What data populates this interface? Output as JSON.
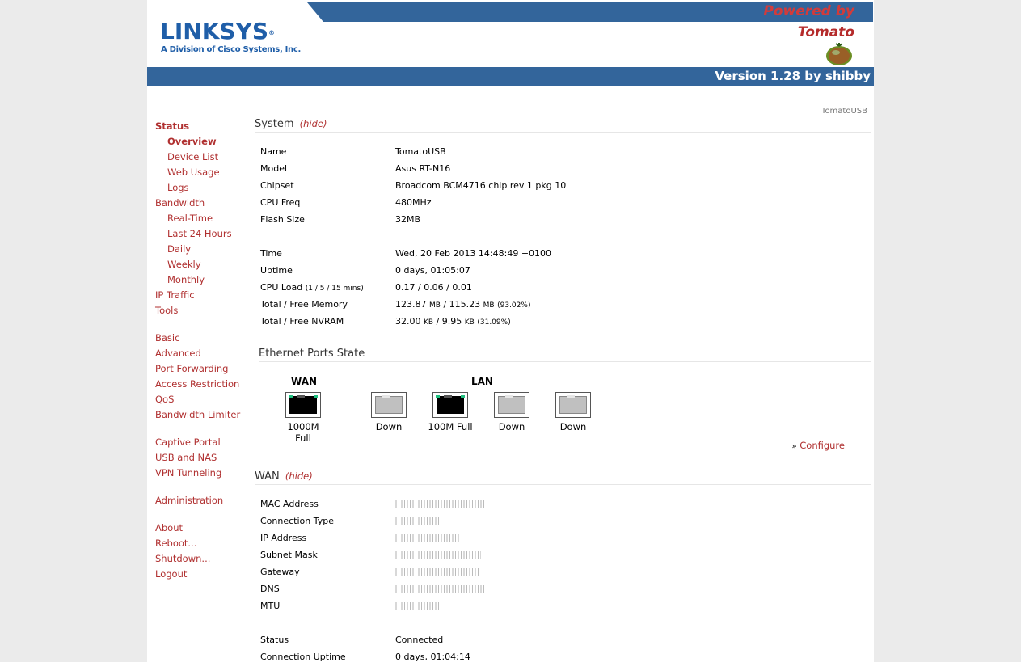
{
  "header": {
    "brand": "LINKSYS",
    "brand_sub": "A Division of Cisco Systems, Inc.",
    "powered_by": "Powered by",
    "tomato": "Tomato",
    "version": "Version 1.28 by shibby",
    "bar_color": "#33659b"
  },
  "nav": {
    "items": [
      {
        "label": "Status",
        "active": true
      },
      {
        "label": "Overview",
        "active": true
      },
      {
        "label": "Device List"
      },
      {
        "label": "Web Usage"
      },
      {
        "label": "Logs"
      },
      {
        "label": "Bandwidth"
      },
      {
        "label": "Real-Time"
      },
      {
        "label": "Last 24 Hours"
      },
      {
        "label": "Daily"
      },
      {
        "label": "Weekly"
      },
      {
        "label": "Monthly"
      },
      {
        "label": "IP Traffic"
      },
      {
        "label": "Tools"
      },
      {
        "label": "Basic"
      },
      {
        "label": "Advanced"
      },
      {
        "label": "Port Forwarding"
      },
      {
        "label": "Access Restriction"
      },
      {
        "label": "QoS"
      },
      {
        "label": "Bandwidth Limiter"
      },
      {
        "label": "Captive Portal"
      },
      {
        "label": "USB and NAS"
      },
      {
        "label": "VPN Tunneling"
      },
      {
        "label": "Administration"
      },
      {
        "label": "About"
      },
      {
        "label": "Reboot..."
      },
      {
        "label": "Shutdown..."
      },
      {
        "label": "Logout"
      }
    ],
    "link_color": "#b03030"
  },
  "content": {
    "site_name": "TomatoUSB",
    "system": {
      "title": "System",
      "hide": "(hide)",
      "rows": [
        {
          "label": "Name",
          "value": "TomatoUSB"
        },
        {
          "label": "Model",
          "value": "Asus RT-N16"
        },
        {
          "label": "Chipset",
          "value": "Broadcom BCM4716 chip rev 1 pkg 10"
        },
        {
          "label": "CPU Freq",
          "value": "480MHz"
        },
        {
          "label": "Flash Size",
          "value": "32MB"
        },
        {
          "label": "Time",
          "value": "Wed, 20 Feb 2013 14:48:49 +0100"
        },
        {
          "label": "Uptime",
          "value": "0 days, 01:05:07"
        },
        {
          "label": "CPU Load",
          "label_small": "(1 / 5 / 15 mins)",
          "value": "0.17 / 0.06 / 0.01"
        },
        {
          "label": "Total / Free Memory",
          "value_parts": [
            "123.87",
            "MB",
            "/ 115.23",
            "MB",
            "(93.02%)"
          ]
        },
        {
          "label": "Total / Free NVRAM",
          "value_parts": [
            "32.00",
            "KB",
            "/ 9.95",
            "KB",
            "(31.09%)"
          ]
        }
      ]
    },
    "ethernet": {
      "title": "Ethernet Ports State",
      "wan_label": "WAN",
      "lan_label": "LAN",
      "ports": [
        {
          "status": "1000M Full",
          "up": true
        },
        {
          "status": "Down",
          "up": false
        },
        {
          "status": "100M Full",
          "up": true
        },
        {
          "status": "Down",
          "up": false
        },
        {
          "status": "Down",
          "up": false
        }
      ],
      "configure": "Configure"
    },
    "wan": {
      "title": "WAN",
      "hide": "(hide)",
      "rows": [
        {
          "label": "MAC Address"
        },
        {
          "label": "Connection Type"
        },
        {
          "label": "IP Address"
        },
        {
          "label": "Subnet Mask"
        },
        {
          "label": "Gateway"
        },
        {
          "label": "DNS"
        },
        {
          "label": "MTU"
        },
        {
          "label": "Status",
          "value": "Connected"
        },
        {
          "label": "Connection Uptime",
          "value": "0 days, 01:04:14"
        }
      ]
    }
  }
}
